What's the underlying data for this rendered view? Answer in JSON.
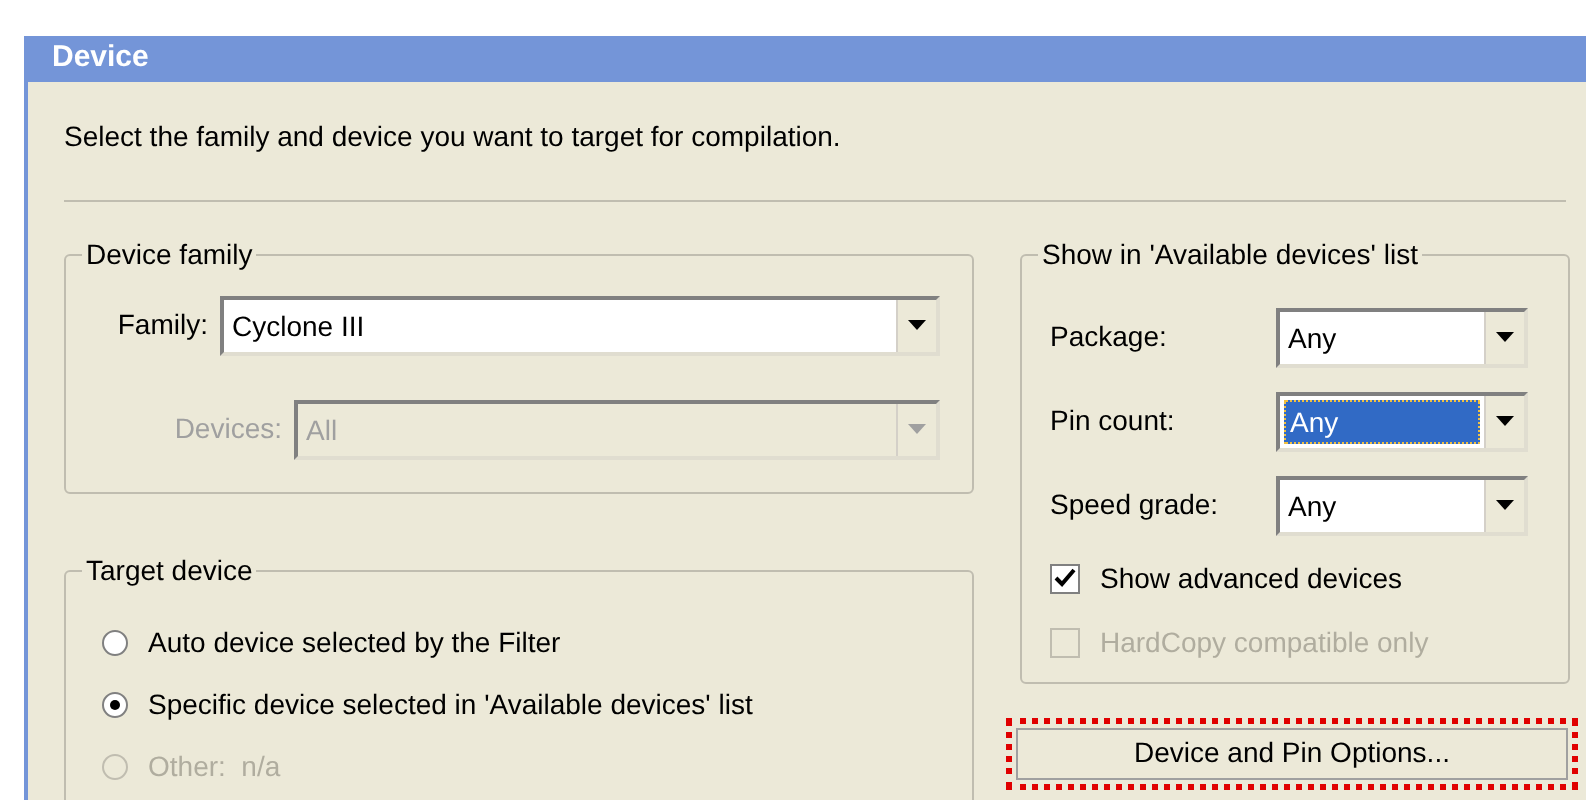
{
  "window": {
    "title": "Device"
  },
  "instruction": "Select the family and device you want to target for compilation.",
  "device_family": {
    "title": "Device family",
    "fields": [
      {
        "label": "Family:",
        "value": "Cyclone III",
        "disabled": false
      },
      {
        "label": "Devices:",
        "value": "All",
        "disabled": true
      }
    ]
  },
  "target_device": {
    "title": "Target device",
    "options": [
      {
        "label": "Auto device selected by the Filter",
        "selected": false,
        "disabled": false
      },
      {
        "label": "Specific device selected in 'Available devices' list",
        "selected": true,
        "disabled": false
      },
      {
        "label": "Other:  n/a",
        "selected": false,
        "disabled": true
      }
    ]
  },
  "filter": {
    "title": "Show in 'Available devices' list",
    "fields": [
      {
        "label": "Package:",
        "value": "Any",
        "selected": false
      },
      {
        "label": "Pin count:",
        "value": "Any",
        "selected": true
      },
      {
        "label": "Speed grade:",
        "value": "Any",
        "selected": false
      }
    ],
    "checkboxes": [
      {
        "label": "Show advanced devices",
        "checked": true,
        "disabled": false
      },
      {
        "label": "HardCopy compatible only",
        "checked": false,
        "disabled": true
      }
    ]
  },
  "button": {
    "label": "Device and Pin Options..."
  }
}
